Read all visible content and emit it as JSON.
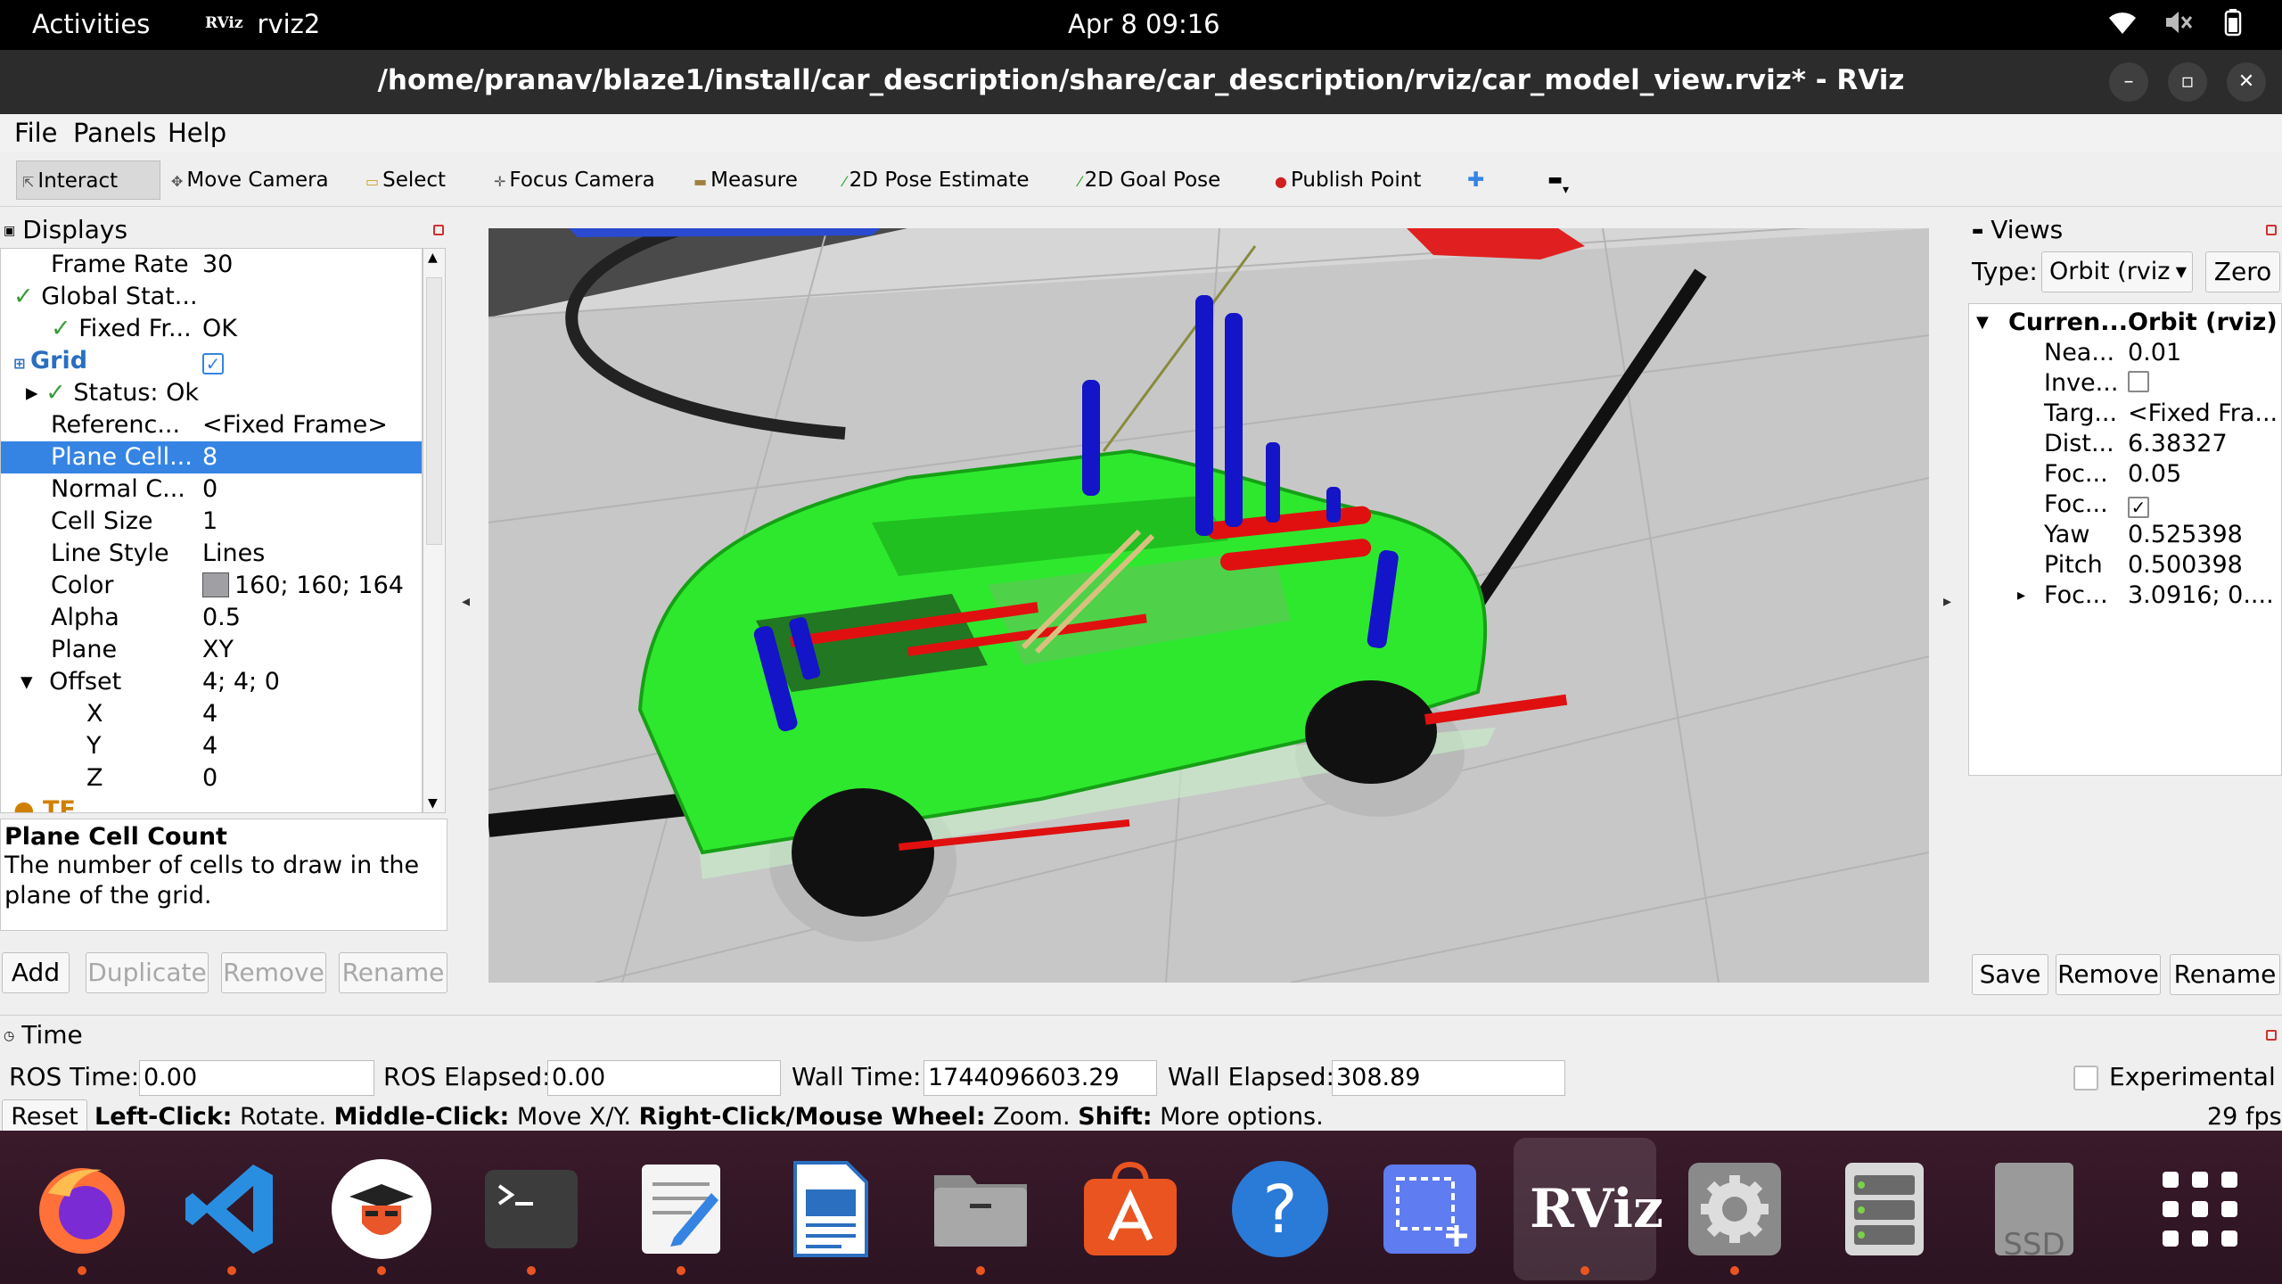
{
  "topbar": {
    "activities": "Activities",
    "app_name": "rviz2",
    "app_logo_text": "RViz",
    "clock": "Apr 8  09:16",
    "icons": [
      "wifi-icon",
      "volume-muted-icon",
      "battery-icon"
    ]
  },
  "window": {
    "title": "/home/pranav/blaze1/install/car_description/share/car_description/rviz/car_model_view.rviz* - RViz",
    "controls": [
      "minimize-icon",
      "maximize-icon",
      "close-icon"
    ]
  },
  "menubar": [
    "File",
    "Panels",
    "Help"
  ],
  "toolbar": {
    "interact": "Interact",
    "move_camera": "Move Camera",
    "select": "Select",
    "focus_camera": "Focus Camera",
    "measure": "Measure",
    "pose_estimate": "2D Pose Estimate",
    "goal_pose": "2D Goal Pose",
    "publish_point": "Publish Point"
  },
  "displays": {
    "title": "Displays",
    "rows": [
      {
        "key": "Frame Rate",
        "value": "30"
      },
      {
        "key": "Global Stat...",
        "value": ""
      },
      {
        "key": "Fixed Fr...",
        "value": "OK"
      },
      {
        "key": "Grid",
        "value": ""
      },
      {
        "key": "Status: Ok",
        "value": ""
      },
      {
        "key": "Referenc...",
        "value": "<Fixed Frame>"
      },
      {
        "key": "Plane Cell...",
        "value": "8"
      },
      {
        "key": "Normal C...",
        "value": "0"
      },
      {
        "key": "Cell Size",
        "value": "1"
      },
      {
        "key": "Line Style",
        "value": "Lines"
      },
      {
        "key": "Color",
        "value": "160; 160; 164"
      },
      {
        "key": "Alpha",
        "value": "0.5"
      },
      {
        "key": "Plane",
        "value": "XY"
      },
      {
        "key": "Offset",
        "value": "4; 4; 0"
      },
      {
        "key": "X",
        "value": "4"
      },
      {
        "key": "Y",
        "value": "4"
      },
      {
        "key": "Z",
        "value": "0"
      },
      {
        "key": "TF",
        "value": ""
      }
    ],
    "grid_color": "#a0a0a4",
    "desc_title": "Plane Cell Count",
    "desc_text": "The number of cells to draw in the plane of the grid.",
    "buttons": {
      "add": "Add",
      "duplicate": "Duplicate",
      "remove": "Remove",
      "rename": "Rename"
    }
  },
  "views": {
    "title": "Views",
    "type_label": "Type:",
    "type_value": "Orbit (rviz",
    "zero": "Zero",
    "header_key": "Curren...",
    "header_value": "Orbit (rviz)",
    "rows": [
      {
        "key": "Nea...",
        "value": "0.01"
      },
      {
        "key": "Inve...",
        "value": ""
      },
      {
        "key": "Targ...",
        "value": "<Fixed Fra..."
      },
      {
        "key": "Dist...",
        "value": "6.38327"
      },
      {
        "key": "Foc...",
        "value": "0.05"
      },
      {
        "key": "Foc...",
        "value": ""
      },
      {
        "key": "Yaw",
        "value": "0.525398"
      },
      {
        "key": "Pitch",
        "value": "0.500398"
      },
      {
        "key": "Foc...",
        "value": "3.0916; 0...."
      }
    ],
    "buttons": {
      "save": "Save",
      "remove": "Remove",
      "rename": "Rename"
    }
  },
  "time": {
    "title": "Time",
    "ros_time_label": "ROS Time:",
    "ros_time": "0.00",
    "ros_elapsed_label": "ROS Elapsed:",
    "ros_elapsed": "0.00",
    "wall_time_label": "Wall Time:",
    "wall_time": "1744096603.29",
    "wall_elapsed_label": "Wall Elapsed:",
    "wall_elapsed": "308.89",
    "experimental": "Experimental",
    "reset": "Reset",
    "hint_left_b": "Left-Click:",
    "hint_left": " Rotate. ",
    "hint_mid_b": "Middle-Click:",
    "hint_mid": " Move X/Y. ",
    "hint_right_b": "Right-Click/Mouse Wheel:",
    "hint_right": " Zoom. ",
    "hint_shift_b": "Shift:",
    "hint_shift": " More options.",
    "fps": "29 fps"
  },
  "dock": {
    "rviz_label": "RViz",
    "ssd_label": "SSD",
    "items": [
      "firefox-icon",
      "vscode-icon",
      "anonymous-app-icon",
      "terminal-icon",
      "text-editor-icon",
      "libreoffice-writer-icon",
      "files-icon",
      "app-center-icon",
      "help-icon",
      "screenshot-icon",
      "rviz-icon",
      "settings-icon",
      "disks-icon",
      "ssd-drive-icon",
      "show-apps-icon"
    ]
  }
}
